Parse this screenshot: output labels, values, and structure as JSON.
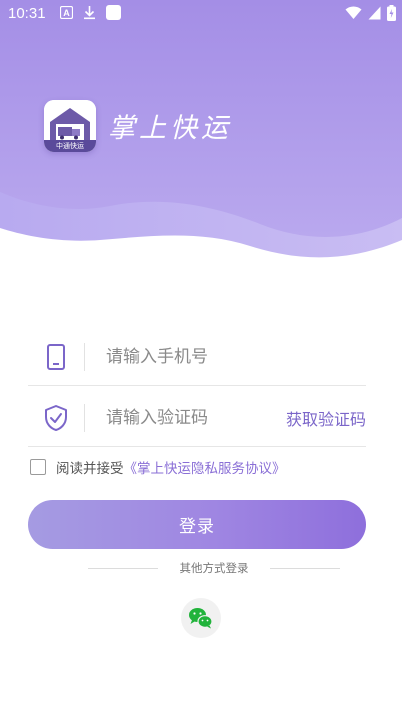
{
  "status_bar": {
    "time": "10:31",
    "left_icons": [
      "a-box-icon",
      "download-icon",
      "square-icon"
    ],
    "right_icons": [
      "wifi-icon",
      "signal-icon",
      "battery-icon"
    ]
  },
  "header": {
    "app_title": "掌上快运",
    "logo": {
      "label": "中通快运",
      "icon": "warehouse-truck-icon"
    },
    "gradient_colors": [
      "#a48ee6",
      "#b7a6ee"
    ]
  },
  "form": {
    "phone": {
      "placeholder": "请输入手机号",
      "value": "",
      "icon": "phone-icon"
    },
    "code": {
      "placeholder": "请输入验证码",
      "value": "",
      "icon": "shield-check-icon",
      "action_label": "获取验证码"
    }
  },
  "agreement": {
    "checked": false,
    "prefix": "阅读并接受",
    "link_text": "《掌上快运隐私服务协议》"
  },
  "login_button": {
    "label": "登录"
  },
  "other_login": {
    "label": "其他方式登录",
    "options": [
      {
        "icon": "wechat-icon"
      }
    ]
  },
  "colors": {
    "accent": "#7b66c9",
    "button_start": "#a59be2",
    "button_end": "#8e6fdc",
    "wechat_green": "#21b33b"
  }
}
